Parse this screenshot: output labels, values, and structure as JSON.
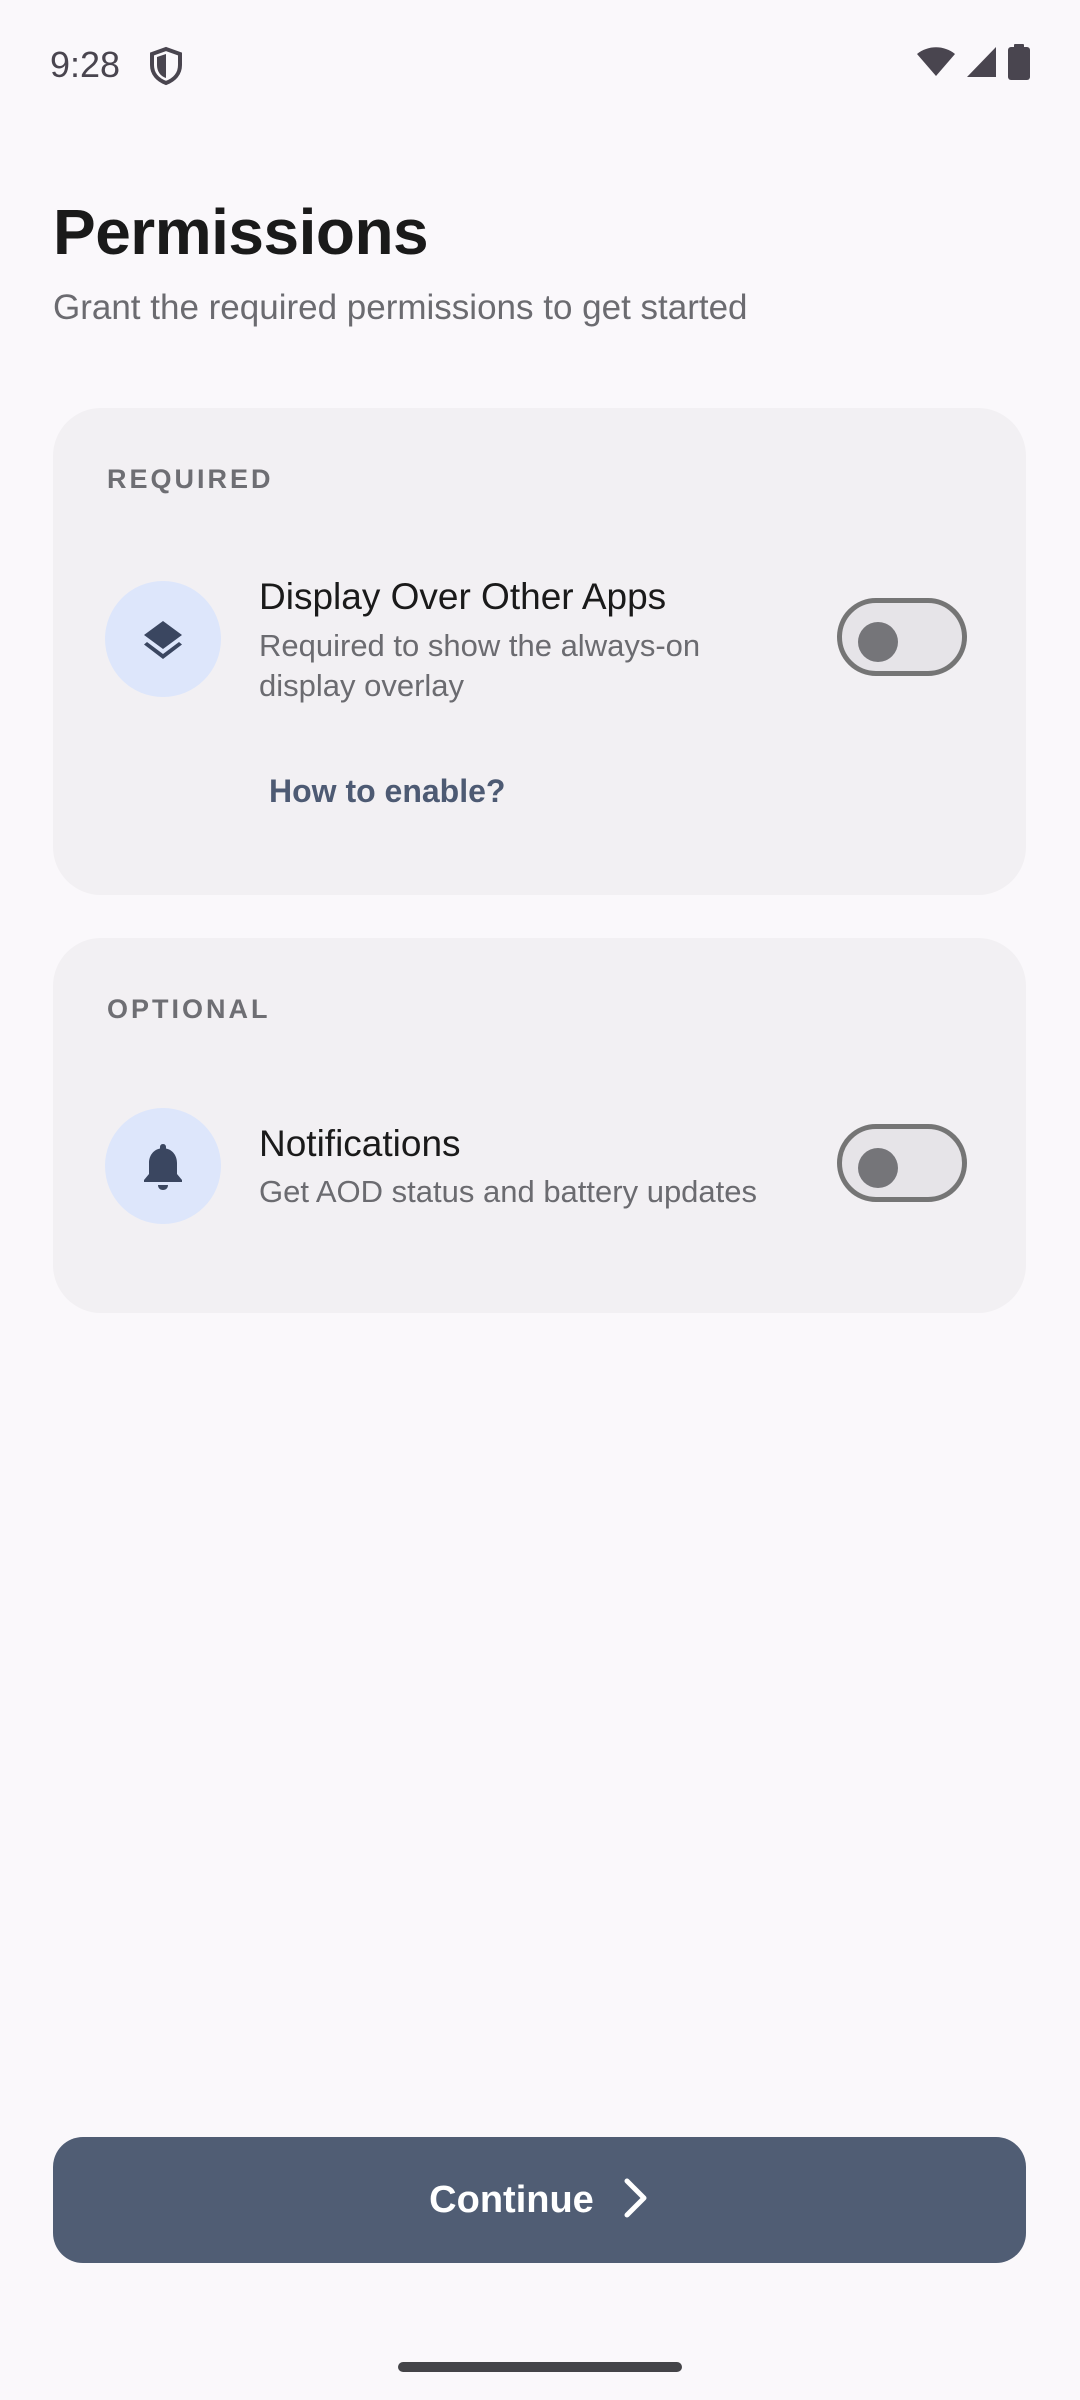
{
  "status_bar": {
    "time": "9:28",
    "icons": [
      "shield-icon",
      "wifi-icon",
      "cellular-signal-icon",
      "battery-icon"
    ]
  },
  "header": {
    "title": "Permissions",
    "subtitle": "Grant the required permissions to get started"
  },
  "required_section": {
    "label": "REQUIRED",
    "permission": {
      "icon": "layers-icon",
      "title": "Display Over Other Apps",
      "description": "Required to show the always-on display overlay",
      "enabled": false
    },
    "help_link": "How to enable?"
  },
  "optional_section": {
    "label": "OPTIONAL",
    "permission": {
      "icon": "bell-icon",
      "title": "Notifications",
      "description": "Get AOD status and battery updates",
      "enabled": false
    }
  },
  "footer": {
    "continue_label": "Continue",
    "continue_icon": "chevron-right-icon"
  },
  "colors": {
    "background": "#faf8fb",
    "card": "#f2f0f3",
    "icon_circle": "#dde6fb",
    "accent": "#505d74",
    "icon_foreground": "#3a4660"
  }
}
